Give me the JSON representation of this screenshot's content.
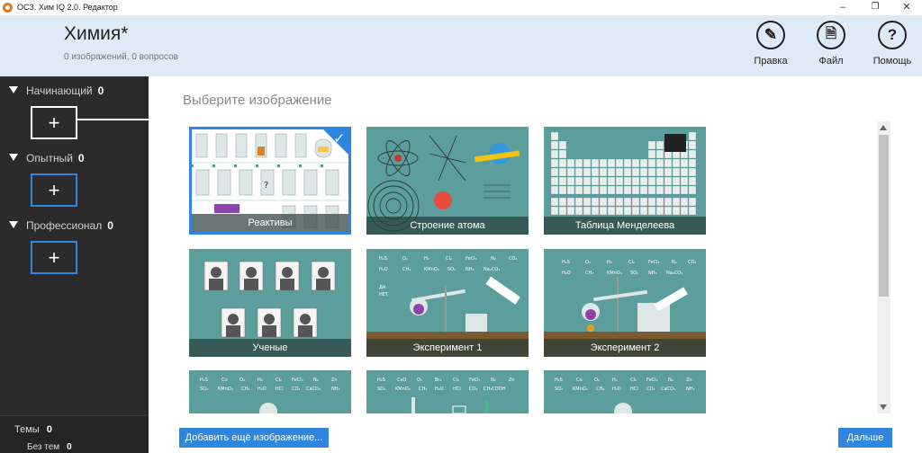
{
  "window": {
    "title": "ОСЗ. Хим IQ 2.0. Редактор"
  },
  "header": {
    "title": "Химия*",
    "subtitle": "0 изображений, 0 вопросов",
    "buttons": {
      "edit": "Правка",
      "file": "Файл",
      "help": "Помощь"
    }
  },
  "sidebar": {
    "levels": [
      {
        "label": "Начинающий",
        "count": "0"
      },
      {
        "label": "Опытный",
        "count": "0"
      },
      {
        "label": "Профессионал",
        "count": "0"
      }
    ],
    "add_symbol": "+",
    "themes_label": "Темы",
    "themes_count": "0",
    "no_theme_label": "Без тем",
    "no_theme_count": "0"
  },
  "main": {
    "heading": "Выберите изображение",
    "tiles": [
      {
        "caption": "Реактивы",
        "selected": true
      },
      {
        "caption": "Строение атома"
      },
      {
        "caption": "Таблица Менделеева"
      },
      {
        "caption": "Ученые"
      },
      {
        "caption": "Эксперимент 1"
      },
      {
        "caption": "Эксперимент 2"
      },
      {
        "caption": ""
      },
      {
        "caption": ""
      },
      {
        "caption": ""
      }
    ],
    "add_more_button": "Добавить ещё изображение...",
    "next_button": "Дальше"
  },
  "colors": {
    "accent": "#2e86de",
    "tile_bg": "#5b9e9c",
    "sidebar_bg": "#2b2b2b",
    "header_bg": "#deebf7"
  }
}
